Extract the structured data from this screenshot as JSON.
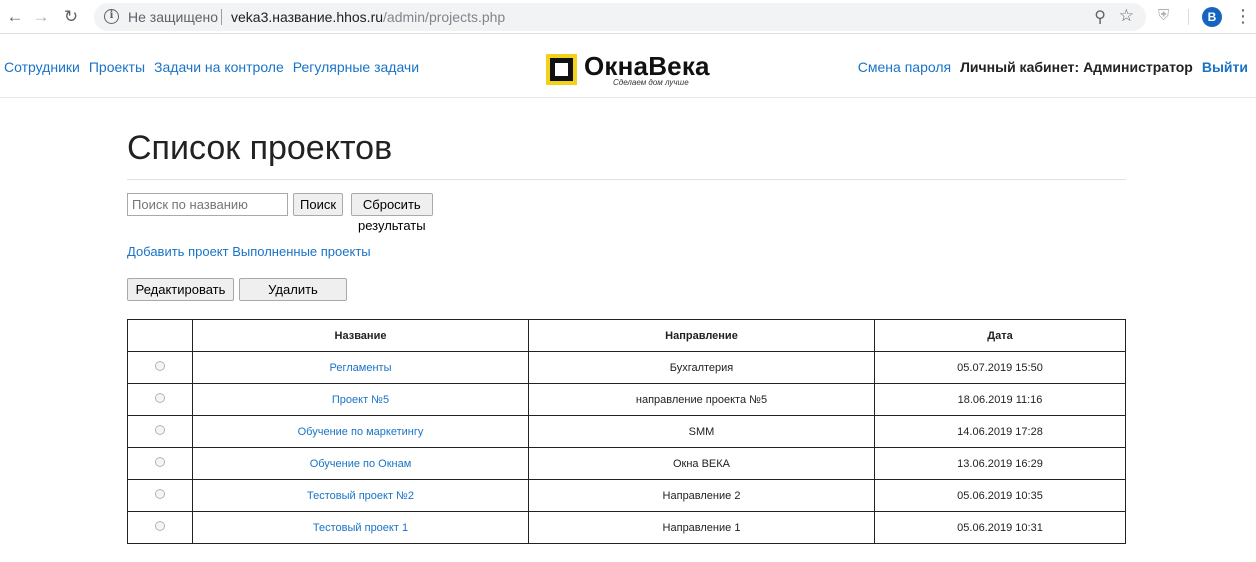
{
  "browser": {
    "insecure_label": "Не защищено",
    "url_host": "veka3.название.hhos.ru",
    "url_path": "/admin/projects.php",
    "avatar_letter": "B"
  },
  "header": {
    "nav_left": [
      "Сотрудники",
      "Проекты",
      "Задачи на контроле",
      "Регулярные задачи"
    ],
    "logo_name": "ОкнаВека",
    "logo_tagline": "Сделаем дом лучше",
    "change_password": "Смена пароля",
    "cabinet": "Личный кабинет: Администратор",
    "logout": "Выйти"
  },
  "page": {
    "title": "Список проектов",
    "search_placeholder": "Поиск по названию",
    "search_button": "Поиск",
    "reset_button": "Сбросить результаты",
    "add_project": "Добавить проект",
    "completed_projects": "Выполненные проекты",
    "edit_button": "Редактировать",
    "delete_button": "Удалить"
  },
  "table": {
    "columns": [
      "",
      "Название",
      "Направление",
      "Дата"
    ],
    "rows": [
      {
        "name": "Регламенты",
        "direction": "Бухгалтерия",
        "date": "05.07.2019 15:50"
      },
      {
        "name": "Проект №5",
        "direction": "направление проекта №5",
        "date": "18.06.2019 11:16"
      },
      {
        "name": "Обучение по маркетингу",
        "direction": "SMM",
        "date": "14.06.2019 17:28"
      },
      {
        "name": "Обучение по Окнам",
        "direction": "Окна ВЕКА",
        "date": "13.06.2019 16:29"
      },
      {
        "name": "Тестовый проект №2",
        "direction": "Направление 2",
        "date": "05.06.2019 10:35"
      },
      {
        "name": "Тестовый проект 1",
        "direction": "Направление 1",
        "date": "05.06.2019 10:31"
      }
    ]
  },
  "colors": {
    "link": "#1a73c7",
    "logo_yellow": "#f2d11c"
  }
}
